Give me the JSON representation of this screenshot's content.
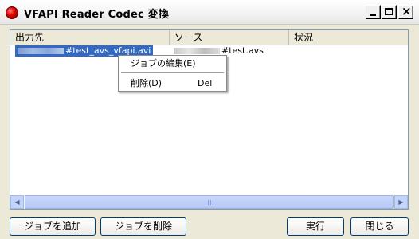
{
  "window": {
    "title": "VFAPI Reader Codec 変換",
    "controls": {
      "minimize_icon": "minimize-icon",
      "maximize_icon": "maximize-icon",
      "close_icon": "close-icon",
      "close_glyph": "×"
    }
  },
  "list": {
    "columns": [
      "出力先",
      "ソース",
      "状況"
    ],
    "rows": [
      {
        "output": "#test_avs_vfapi.avi",
        "source": "#test.avs",
        "status": ""
      }
    ]
  },
  "context_menu": {
    "items": [
      {
        "label": "ジョブの編集(E)",
        "shortcut": ""
      },
      {
        "label": "削除(D)",
        "shortcut": "Del"
      }
    ]
  },
  "buttons": {
    "add_job": "ジョブを追加",
    "delete_job": "ジョブを削除",
    "run": "実行",
    "close": "閉じる"
  },
  "colors": {
    "selection": "#316ac5",
    "button_border": "#003c74"
  }
}
